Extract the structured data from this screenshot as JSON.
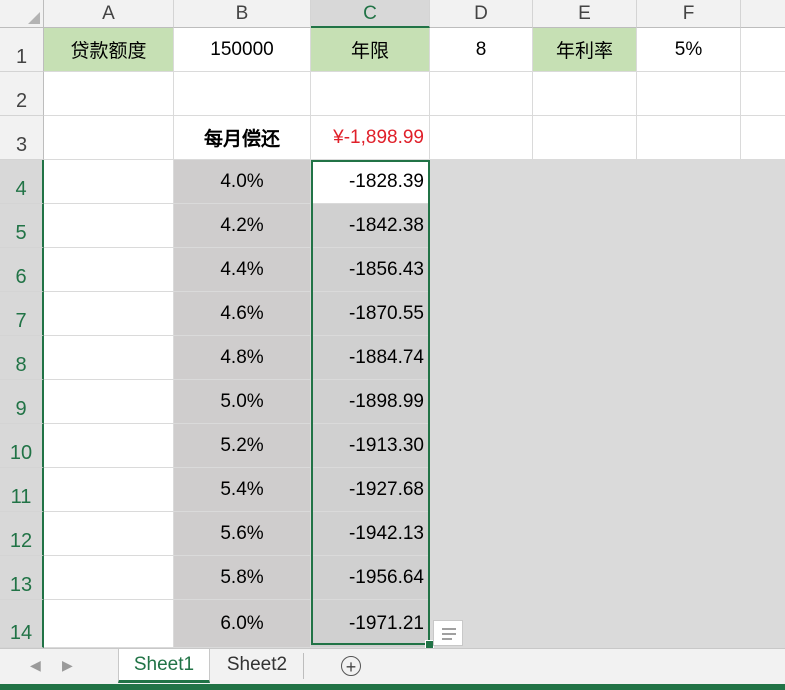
{
  "columns": [
    "A",
    "B",
    "C",
    "D",
    "E",
    "F"
  ],
  "rows": [
    "1",
    "2",
    "3",
    "4",
    "5",
    "6",
    "7",
    "8",
    "9",
    "10",
    "11",
    "12",
    "13",
    "14"
  ],
  "row1": {
    "a": "贷款额度",
    "b": "150000",
    "c": "年限",
    "d": "8",
    "e": "年利率",
    "f": "5%"
  },
  "row3": {
    "b": "每月偿还",
    "c": "¥-1,898.99"
  },
  "table": [
    {
      "rate": "4.0%",
      "payment": "-1828.39"
    },
    {
      "rate": "4.2%",
      "payment": "-1842.38"
    },
    {
      "rate": "4.4%",
      "payment": "-1856.43"
    },
    {
      "rate": "4.6%",
      "payment": "-1870.55"
    },
    {
      "rate": "4.8%",
      "payment": "-1884.74"
    },
    {
      "rate": "5.0%",
      "payment": "-1898.99"
    },
    {
      "rate": "5.2%",
      "payment": "-1913.30"
    },
    {
      "rate": "5.4%",
      "payment": "-1927.68"
    },
    {
      "rate": "5.6%",
      "payment": "-1942.13"
    },
    {
      "rate": "5.8%",
      "payment": "-1956.64"
    },
    {
      "rate": "6.0%",
      "payment": "-1971.21"
    }
  ],
  "sheets": [
    "Sheet1",
    "Sheet2"
  ],
  "active_sheet": "Sheet1",
  "add_sheet_symbol": "+",
  "nav": {
    "prev": "◀",
    "next": "▶"
  },
  "colors": {
    "accent": "#217346",
    "header_fill": "#c6e0b4",
    "rate_fill": "#cfcdcd",
    "negative_text": "#e0202a"
  }
}
